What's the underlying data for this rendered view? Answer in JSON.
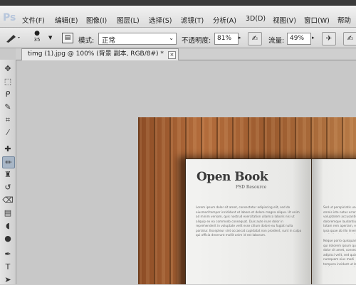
{
  "app": {
    "logo": "Ps"
  },
  "menu": [
    "文件(F)",
    "编辑(E)",
    "图像(I)",
    "图层(L)",
    "选择(S)",
    "滤镜(T)",
    "分析(A)",
    "3D(D)",
    "视图(V)",
    "窗口(W)",
    "帮助"
  ],
  "options": {
    "brush_size": "35",
    "mode_label": "模式:",
    "mode_value": "正常",
    "opacity_label": "不透明度:",
    "opacity_value": "81%",
    "flow_label": "流量:",
    "flow_value": "49%"
  },
  "document": {
    "tab_title": "timg (1).jpg @ 100% (背景 副本, RGB/8#) *",
    "close_glyph": "×"
  },
  "tools": [
    {
      "name": "move-tool-icon",
      "glyph": "✥"
    },
    {
      "name": "marquee-tool-icon",
      "glyph": "⬚"
    },
    {
      "name": "lasso-tool-icon",
      "glyph": "ᑭ"
    },
    {
      "name": "quick-selection-tool-icon",
      "glyph": "✎"
    },
    {
      "name": "crop-tool-icon",
      "glyph": "⌗"
    },
    {
      "name": "eyedropper-tool-icon",
      "glyph": "⁄"
    },
    {
      "name": "healing-brush-tool-icon",
      "glyph": "✚"
    },
    {
      "name": "brush-tool-icon",
      "glyph": "✏"
    },
    {
      "name": "clone-stamp-tool-icon",
      "glyph": "♜"
    },
    {
      "name": "history-brush-tool-icon",
      "glyph": "↺"
    },
    {
      "name": "eraser-tool-icon",
      "glyph": "⌫"
    },
    {
      "name": "gradient-tool-icon",
      "glyph": "▤"
    },
    {
      "name": "blur-tool-icon",
      "glyph": "◖"
    },
    {
      "name": "dodge-tool-icon",
      "glyph": "●"
    },
    {
      "name": "pen-tool-icon",
      "glyph": "✒"
    },
    {
      "name": "type-tool-icon",
      "glyph": "T"
    },
    {
      "name": "path-selection-tool-icon",
      "glyph": "➤"
    }
  ],
  "active_tool": "brush-tool-icon",
  "canvas": {
    "book_title": "Open Book",
    "book_subtitle": "PSD Resource",
    "left_text": "Lorem ipsum dolor sit amet, consectetur adipiscing elit, sed do eiusmod tempor incididunt ut labore et dolore magna aliqua. Ut enim ad minim veniam, quis nostrud exercitation ullamco laboris nisi ut aliquip ex ea commodo consequat. Duis aute irure dolor in reprehenderit in voluptate velit esse cillum dolore eu fugiat nulla pariatur. Excepteur sint occaecat cupidatat non proident, sunt in culpa qui officia deserunt mollit anim id est laborum.",
    "right_text_1": "Sed ut perspiciatis unde omnis iste natus error sit voluptatem accusantium doloremque laudantium, totam rem aperiam, eaque ipsa quae ab illo inventore veritatis et quasi architecto beatae vitae dicta sunt.",
    "right_text_2": "Neque porro quisquam est, qui dolorem ipsum quia dolor sit amet, consectetur, adipisci velit, sed quia non numquam eius modi tempora incidunt ut labore et dolore magnam aliquam quaerat voluptatem."
  }
}
